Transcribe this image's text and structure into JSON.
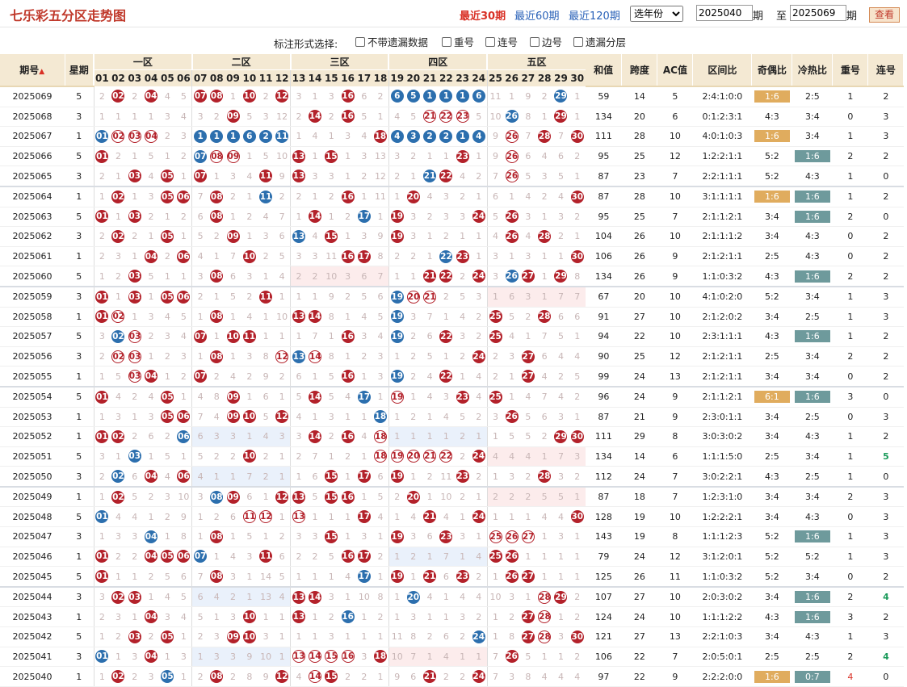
{
  "page": {
    "title": "七乐彩五分区走势图",
    "nav": [
      {
        "label": "最近30期",
        "active": true
      },
      {
        "label": "最近60期",
        "active": false
      },
      {
        "label": "最近120期",
        "active": false
      }
    ],
    "year_select": "选年份",
    "period_from": "2025040",
    "period_label_qi": "期",
    "period_label_to": "至",
    "period_to": "2025069",
    "view_button": "查看",
    "options_label": "标注形式选择:",
    "options": [
      "不带遗漏数据",
      "重号",
      "连号",
      "边号",
      "遗漏分层"
    ]
  },
  "headers": {
    "period": "期号",
    "sort_icon": "sort-arrows",
    "weekday": "星期",
    "zones": [
      "一区",
      "二区",
      "三区",
      "四区",
      "五区"
    ],
    "numbers": [
      "01",
      "02",
      "03",
      "04",
      "05",
      "06",
      "07",
      "08",
      "09",
      "10",
      "11",
      "12",
      "13",
      "14",
      "15",
      "16",
      "17",
      "18",
      "19",
      "20",
      "21",
      "22",
      "23",
      "24",
      "25",
      "26",
      "27",
      "28",
      "29",
      "30"
    ],
    "stats": [
      "和值",
      "跨度",
      "AC值",
      "区间比",
      "奇偶比",
      "冷热比",
      "重号",
      "连号"
    ]
  },
  "colors": {
    "ball_red": "#b3212a",
    "ball_blue": "#2c6fae",
    "header_bg": "#f4e9d3",
    "odd_even_highlight": "#e0ac5e",
    "hot_cold_highlight": "#6e9a9c"
  },
  "rows": [
    {
      "p": "2025069",
      "w": "5",
      "c": "2,r02,2,r04,4,5|r07,r08,1,r10,2,r12|3,1,3,r16,6,2|b6,b5,b1,b1,b1,b6|11,1,9,2,b29,1",
      "s": [
        "59",
        "14",
        "5",
        "2:4:1:0:0",
        "1:6",
        "2:5",
        "1",
        "2"
      ],
      "oh": true
    },
    {
      "p": "2025068",
      "w": "3",
      "c": "1,1,1,1,3,4|3,2,r09,5,3,12|2,r14,2,r16,5,1|4,5,o21,o22,o23,5|10,b26,8,1,r29,1",
      "s": [
        "134",
        "20",
        "6",
        "0:1:2:3:1",
        "4:3",
        "3:4",
        "0",
        "3"
      ]
    },
    {
      "p": "2025067",
      "w": "1",
      "c": "b01,o02,o03,o04,2,3|b1,b1,b1,b6,b2,b11|1,4,1,3,4,r18|b4,b3,b2,b2,b1,b4|9,o26,7,r28,7,r30",
      "s": [
        "111",
        "28",
        "10",
        "4:0:1:0:3",
        "1:6",
        "3:4",
        "1",
        "3"
      ],
      "oh": true
    },
    {
      "p": "2025066",
      "w": "5",
      "c": "r01,2,1,5,1,2|b07,o08,o09,1,5,10|r13,1,r15,1,3,13|3,2,1,1,r23,1|9,o26,6,4,6,2",
      "s": [
        "95",
        "25",
        "12",
        "1:2:2:1:1",
        "5:2",
        "1:6",
        "2",
        "2"
      ],
      "th": true
    },
    {
      "p": "2025065",
      "w": "3",
      "c": "2,1,r03,4,r05,1|r07,1,3,4,r11,9|r13,3,3,1,2,12|2,1,b21,r22,4,2|7,o26,5,3,5,1",
      "s": [
        "87",
        "23",
        "7",
        "2:2:1:1:1",
        "5:2",
        "4:3",
        "1",
        "0"
      ]
    },
    {
      "p": "2025064",
      "w": "1",
      "c": "1,r02,1,3,r05,r06|7,r08,2,1,b11,2|2,1,2,r16,1,11|1,r20,4,3,2,1|6,1,4,2,4,r30",
      "s": [
        "87",
        "28",
        "10",
        "3:1:1:1:1",
        "1:6",
        "1:6",
        "1",
        "2"
      ],
      "oh": true,
      "th": true,
      "gs": true
    },
    {
      "p": "2025063",
      "w": "5",
      "c": "r01,1,r03,2,1,2|6,r08,1,2,4,7|1,r14,1,2,b17,1|r19,3,2,3,3,r24|5,r26,3,1,3,2",
      "s": [
        "95",
        "25",
        "7",
        "2:1:1:2:1",
        "3:4",
        "1:6",
        "2",
        "0"
      ],
      "th": true
    },
    {
      "p": "2025062",
      "w": "3",
      "c": "2,r02,2,1,r05,1|5,2,r09,1,3,6|b13,4,r15,1,3,9|r19,3,1,2,1,1|4,r26,4,r28,2,1",
      "s": [
        "104",
        "26",
        "10",
        "2:1:1:1:2",
        "3:4",
        "4:3",
        "0",
        "2"
      ]
    },
    {
      "p": "2025061",
      "w": "1",
      "c": "2,3,1,r04,2,r06|4,1,7,r10,2,5|3,3,11,r16,r17,8|2,2,1,b22,r23,1|3,1,3,1,1,r30",
      "s": [
        "106",
        "26",
        "9",
        "2:1:2:1:1",
        "2:5",
        "4:3",
        "0",
        "2"
      ]
    },
    {
      "p": "2025060",
      "w": "5",
      "c": "1,2,r03,5,1,1|3,r08,6,3,1,4|zr2,zr2,zr10,zr3,zr6,zr7|1,1,r21,r22,2,r24|3,b26,r27,1,r29,8",
      "s": [
        "134",
        "26",
        "9",
        "1:1:0:3:2",
        "4:3",
        "1:6",
        "2",
        "2"
      ],
      "th": true
    },
    {
      "p": "2025059",
      "w": "3",
      "c": "r01,1,r03,1,r05,r06|2,1,5,2,r11,1|1,1,9,2,5,6|b19,o20,o21,2,5,3|zr1,zr6,zr3,zr1,zr7,zr7",
      "s": [
        "67",
        "20",
        "10",
        "4:1:0:2:0",
        "5:2",
        "3:4",
        "1",
        "3"
      ],
      "gs": true
    },
    {
      "p": "2025058",
      "w": "1",
      "c": "r01,o02,1,3,4,5|1,r08,1,4,1,10|r13,r14,8,1,4,5|b19,3,7,1,4,2|r25,5,2,r28,6,6",
      "s": [
        "91",
        "27",
        "10",
        "2:1:2:0:2",
        "3:4",
        "2:5",
        "1",
        "3"
      ]
    },
    {
      "p": "2025057",
      "w": "5",
      "c": "3,b02,o03,2,3,4|r07,1,r10,r11,1,1|1,7,1,r16,3,4|b19,2,6,r22,3,2|r25,4,1,7,5,1",
      "s": [
        "94",
        "22",
        "10",
        "2:3:1:1:1",
        "4:3",
        "1:6",
        "1",
        "2"
      ],
      "th": true
    },
    {
      "p": "2025056",
      "w": "3",
      "c": "2,o02,o03,1,2,3|1,r08,1,3,8,o12|b13,o14,8,1,2,3|1,2,5,1,2,r24|2,3,r27,6,4,4",
      "s": [
        "90",
        "25",
        "12",
        "2:1:2:1:1",
        "2:5",
        "3:4",
        "2",
        "2"
      ]
    },
    {
      "p": "2025055",
      "w": "1",
      "c": "1,5,o03,r04,1,2|r07,2,4,2,9,2|6,1,5,r16,1,3|b19,2,4,r22,1,4|2,1,r27,4,2,5",
      "s": [
        "99",
        "24",
        "13",
        "2:1:2:1:1",
        "3:4",
        "3:4",
        "0",
        "2"
      ]
    },
    {
      "p": "2025054",
      "w": "5",
      "c": "r01,4,2,4,r05,1|4,8,r09,1,6,1|5,r14,5,4,b17,1|o19,1,4,3,r23,4|r25,1,4,7,4,2",
      "s": [
        "96",
        "24",
        "9",
        "2:1:1:2:1",
        "6:1",
        "1:6",
        "3",
        "0"
      ],
      "oh": true,
      "th": true,
      "gs": true
    },
    {
      "p": "2025053",
      "w": "1",
      "c": "1,3,1,3,r05,r06|7,4,r09,r10,5,r12|4,1,3,1,1,b18|1,2,1,4,5,2|3,r26,5,6,3,1",
      "s": [
        "87",
        "21",
        "9",
        "2:3:0:1:1",
        "3:4",
        "2:5",
        "0",
        "3"
      ]
    },
    {
      "p": "2025052",
      "w": "1",
      "c": "r01,r02,2,6,2,b06|zb6,zb3,zb3,zb1,zb4,zb3|3,r14,2,r16,4,o18|zb1,zb1,zb1,zb1,zb2,zb1|1,5,5,2,r29,r30",
      "s": [
        "111",
        "29",
        "8",
        "3:0:3:0:2",
        "3:4",
        "4:3",
        "1",
        "2"
      ]
    },
    {
      "p": "2025051",
      "w": "5",
      "c": "3,1,b03,1,5,1|5,2,2,r10,2,1|2,7,1,2,1,o18|o19,o20,o21,o22,2,r24|zr4,zr4,zr4,zr1,zr7,zr3",
      "s": [
        "134",
        "14",
        "6",
        "1:1:1:5:0",
        "2:5",
        "3:4",
        "1",
        "g5"
      ]
    },
    {
      "p": "2025050",
      "w": "3",
      "c": "2,b02,6,r04,4,r06|zb4,zb1,zb1,zb7,zb2,zb1|1,6,r15,1,r17,6|r19,1,2,11,r23,2|1,3,2,r28,3,2",
      "s": [
        "112",
        "24",
        "7",
        "3:0:2:2:1",
        "4:3",
        "2:5",
        "1",
        "0"
      ]
    },
    {
      "p": "2025049",
      "w": "1",
      "c": "1,r02,5,2,3,10|3,b08,r09,6,1,r12|r13,5,r15,r16,1,5|2,r20,1,10,2,1|zr2,zr2,zr2,zr5,zr5,zr1",
      "s": [
        "87",
        "18",
        "7",
        "1:2:3:1:0",
        "3:4",
        "3:4",
        "2",
        "3"
      ],
      "gs": true
    },
    {
      "p": "2025048",
      "w": "5",
      "c": "b01,4,4,1,2,9|1,2,6,o11,o12,1|o13,1,1,1,r17,4|1,4,r21,4,1,r24|1,1,1,4,4,r30",
      "s": [
        "128",
        "19",
        "10",
        "1:2:2:2:1",
        "3:4",
        "4:3",
        "0",
        "3"
      ]
    },
    {
      "p": "2025047",
      "w": "3",
      "c": "1,3,3,b04,1,8|1,r08,1,5,1,2|3,3,r15,1,3,1|r19,3,6,r23,3,1|o25,o26,o27,1,3,1",
      "s": [
        "143",
        "19",
        "8",
        "1:1:1:2:3",
        "5:2",
        "1:6",
        "1",
        "3"
      ],
      "th": true
    },
    {
      "p": "2025046",
      "w": "1",
      "c": "r01,2,2,r04,r05,r06|b07,1,4,3,r11,6|2,2,5,r16,r17,2|zb1,zb2,zb1,zb7,zb1,zb4|r25,r26,1,1,1,1",
      "s": [
        "79",
        "24",
        "12",
        "3:1:2:0:1",
        "5:2",
        "5:2",
        "1",
        "3"
      ]
    },
    {
      "p": "2025045",
      "w": "5",
      "c": "r01,1,1,2,5,6|7,r08,3,1,14,5|1,1,1,4,b17,1|r19,1,r21,6,r23,2|1,r26,r27,1,1,1",
      "s": [
        "125",
        "26",
        "11",
        "1:1:0:3:2",
        "5:2",
        "3:4",
        "0",
        "2"
      ]
    },
    {
      "p": "2025044",
      "w": "3",
      "c": "3,r02,r03,1,4,5|zb6,zb4,zb2,zb1,zb13,zb4|r13,r14,3,1,10,8|1,b20,4,1,4,4|10,3,1,o28,r29,2",
      "s": [
        "107",
        "27",
        "10",
        "2:0:3:0:2",
        "3:4",
        "1:6",
        "2",
        "g4"
      ],
      "th": true,
      "gs": true
    },
    {
      "p": "2025043",
      "w": "1",
      "c": "2,3,1,r04,3,4|5,1,3,r10,1,1|r13,1,2,b16,1,2|1,3,1,1,3,2|1,2,r27,o28,1,2",
      "s": [
        "124",
        "24",
        "10",
        "1:1:1:2:2",
        "4:3",
        "1:6",
        "3",
        "2"
      ],
      "th": true
    },
    {
      "p": "2025042",
      "w": "5",
      "c": "1,2,r03,2,r05,1|2,3,r09,r10,3,1|1,1,3,1,1,1|11,8,2,6,2,b24|1,8,r27,o28,3,r30",
      "s": [
        "121",
        "27",
        "13",
        "2:2:1:0:3",
        "3:4",
        "4:3",
        "1",
        "3"
      ]
    },
    {
      "p": "2025041",
      "w": "3",
      "c": "b01,1,3,r04,1,3|zb1,zb3,zb3,zb9,zb10,zb1|o13,o14,o15,o16,3,r18|zr10,zr7,zr1,zr4,zr1,zr1|7,r26,5,1,1,2",
      "s": [
        "106",
        "22",
        "7",
        "2:0:5:0:1",
        "2:5",
        "2:5",
        "2",
        "g4"
      ]
    },
    {
      "p": "2025040",
      "w": "1",
      "c": "1,r02,2,3,b05,1|2,r08,2,8,9,r12|4,o14,r15,2,2,1|9,6,r21,2,2,r24|7,3,8,4,4,4",
      "s": [
        "97",
        "22",
        "9",
        "2:2:2:0:0",
        "1:6",
        "0:7",
        "r4",
        "0"
      ],
      "oh": true,
      "th": true
    }
  ]
}
